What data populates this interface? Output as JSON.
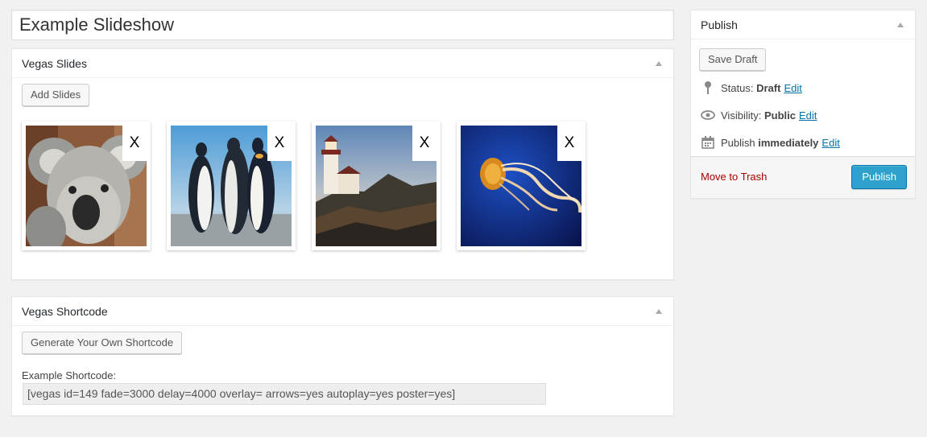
{
  "post": {
    "title": "Example Slideshow"
  },
  "slides_box": {
    "title": "Vegas Slides",
    "add_button": "Add Slides",
    "remove_label": "X",
    "slides": [
      {
        "image": "koala"
      },
      {
        "image": "penguins"
      },
      {
        "image": "lighthouse"
      },
      {
        "image": "jellyfish"
      }
    ]
  },
  "shortcode_box": {
    "title": "Vegas Shortcode",
    "generate_button": "Generate Your Own Shortcode",
    "example_label": "Example Shortcode:",
    "example_value": "[vegas id=149 fade=3000 delay=4000 overlay= arrows=yes autoplay=yes poster=yes]"
  },
  "publish_box": {
    "title": "Publish",
    "save_draft": "Save Draft",
    "status_label": "Status:",
    "status_value": "Draft",
    "visibility_label": "Visibility:",
    "visibility_value": "Public",
    "schedule_label": "Publish",
    "schedule_value": "immediately",
    "edit_link": "Edit",
    "trash_link": "Move to Trash",
    "publish_button": "Publish"
  },
  "colors": {
    "background": "#f1f1f1",
    "primary": "#2ea2cc",
    "link": "#0073aa",
    "trash": "#aa0000"
  }
}
